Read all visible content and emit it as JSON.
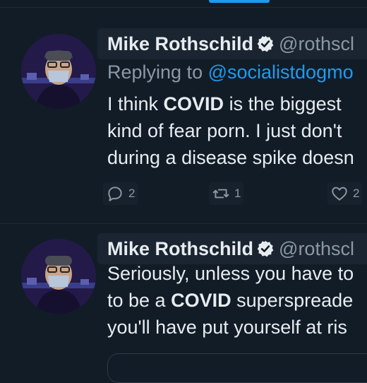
{
  "tweets": [
    {
      "author": {
        "name": "Mike Rothschild",
        "handle": "@rothscl"
      },
      "replying": {
        "prefix": "Replying to ",
        "handle": "@socialistdogmo"
      },
      "lines": [
        {
          "pre": "I think ",
          "bold": "COVID",
          "post": " is the biggest"
        },
        {
          "pre": "kind of fear porn. I just don't",
          "bold": "",
          "post": ""
        },
        {
          "pre": "during a disease spike doesn",
          "bold": "",
          "post": ""
        }
      ],
      "actions": {
        "replies": "2",
        "retweets": "1",
        "likes": "2"
      }
    },
    {
      "author": {
        "name": "Mike Rothschild",
        "handle": "@rothscl"
      },
      "lines": [
        {
          "pre": "Seriously, unless you have to",
          "bold": "",
          "post": ""
        },
        {
          "pre": "to be a ",
          "bold": "COVID",
          "post": " superspreade"
        },
        {
          "pre": "you'll have put yourself at ris",
          "bold": "",
          "post": ""
        }
      ]
    }
  ],
  "icons": {
    "verified": "verified-badge-icon",
    "reply": "reply-icon",
    "retweet": "retweet-icon",
    "like": "heart-icon"
  },
  "colors": {
    "background": "#121c27",
    "accent": "#1d9bf0",
    "muted": "#8b98a5",
    "text": "#e7ecf0"
  }
}
